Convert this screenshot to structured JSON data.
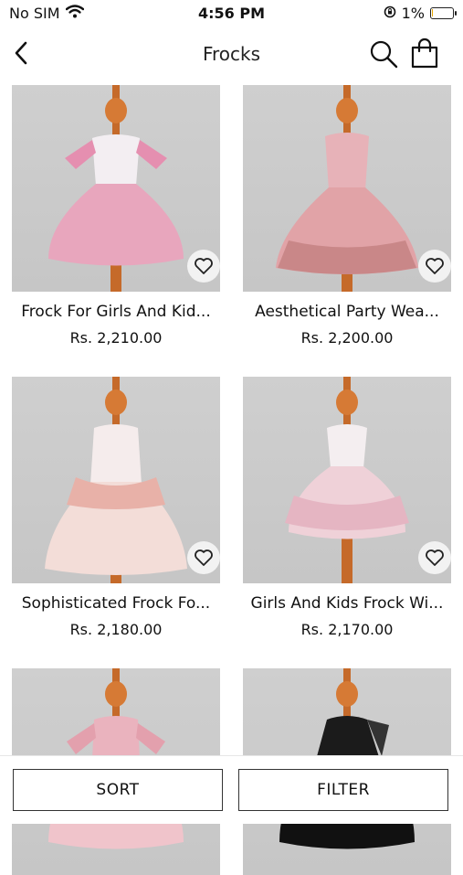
{
  "status": {
    "carrier": "No SIM",
    "time": "4:56 PM",
    "battery": "1%"
  },
  "nav": {
    "title": "Frocks"
  },
  "products": [
    {
      "name": "Frock For Girls And Kid...",
      "price": "Rs. 2,210.00",
      "colors": {
        "top": "#f3eef2",
        "skirt": "#e8a6bd",
        "accent": "#e58fb0"
      }
    },
    {
      "name": "Aesthetical Party Wea...",
      "price": "Rs. 2,200.00",
      "colors": {
        "top": "#e7b2b8",
        "skirt": "#e1a3a7",
        "accent": "#c98788"
      }
    },
    {
      "name": "Sophisticated Frock Fo...",
      "price": "Rs. 2,180.00",
      "colors": {
        "top": "#f5ecec",
        "skirt": "#f3ddd8",
        "accent": "#e8b1a8"
      }
    },
    {
      "name": "Girls And Kids Frock Wi...",
      "price": "Rs. 2,170.00",
      "colors": {
        "top": "#f4eef0",
        "skirt": "#efd1d8",
        "accent": "#e5b5c2"
      }
    },
    {
      "name": "",
      "price": "",
      "colors": {
        "top": "#eab3be",
        "skirt": "#f0c4cb",
        "accent": "#e3a0ad"
      }
    },
    {
      "name": "",
      "price": "",
      "colors": {
        "top": "#1b1b1b",
        "skirt": "#111111",
        "accent": "#333333"
      }
    }
  ],
  "bottom": {
    "sort_label": "SORT",
    "filter_label": "FILTER"
  }
}
